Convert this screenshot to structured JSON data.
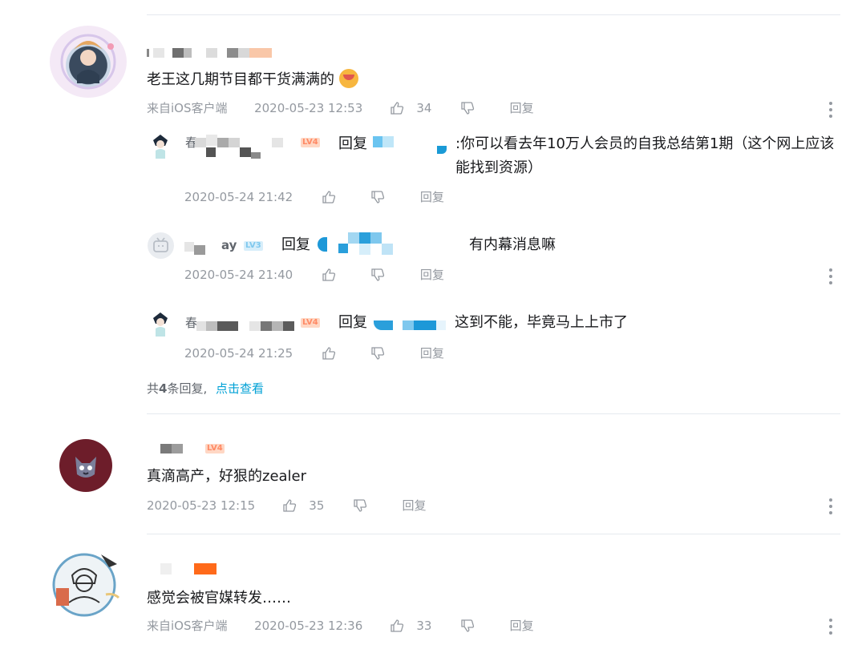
{
  "comments": [
    {
      "text": "老王这几期节目都干货满满的",
      "source": "来自iOS客户端",
      "time": "2020-05-23 12:53",
      "likes": "34",
      "reply_label": "回复",
      "replies": [
        {
          "name_prefix": "春",
          "level": "LV4",
          "reply_word": "回复",
          "text": ":你可以看去年10万人会员的自我总结第1期（这个网上应该能找到资源）",
          "time": "2020-05-24 21:42",
          "reply_label": "回复"
        },
        {
          "name_suffix": "ay",
          "level": "LV3",
          "reply_word": "回复",
          "text": "有内幕消息嘛",
          "time": "2020-05-24 21:40",
          "reply_label": "回复"
        },
        {
          "name_prefix": "春",
          "level": "LV4",
          "reply_word": "回复",
          "text": "这到不能，毕竟马上上市了",
          "time": "2020-05-24 21:25",
          "reply_label": "回复"
        }
      ],
      "footer_total": "共",
      "footer_count": "4",
      "footer_tail": "条回复,",
      "footer_link": "点击查看"
    },
    {
      "level": "LV4",
      "text": "真滴高产，好狠的zealer",
      "time": "2020-05-23 12:15",
      "likes": "35",
      "reply_label": "回复"
    },
    {
      "text": "感觉会被官媒转发……",
      "source": "来自iOS客户端",
      "time": "2020-05-23 12:36",
      "likes": "33",
      "reply_label": "回复"
    }
  ],
  "colors": {
    "link": "#00a1d6",
    "meta": "#9499a0",
    "level_orange": "#ff8a65",
    "level_blue": "#7fc8ee"
  }
}
